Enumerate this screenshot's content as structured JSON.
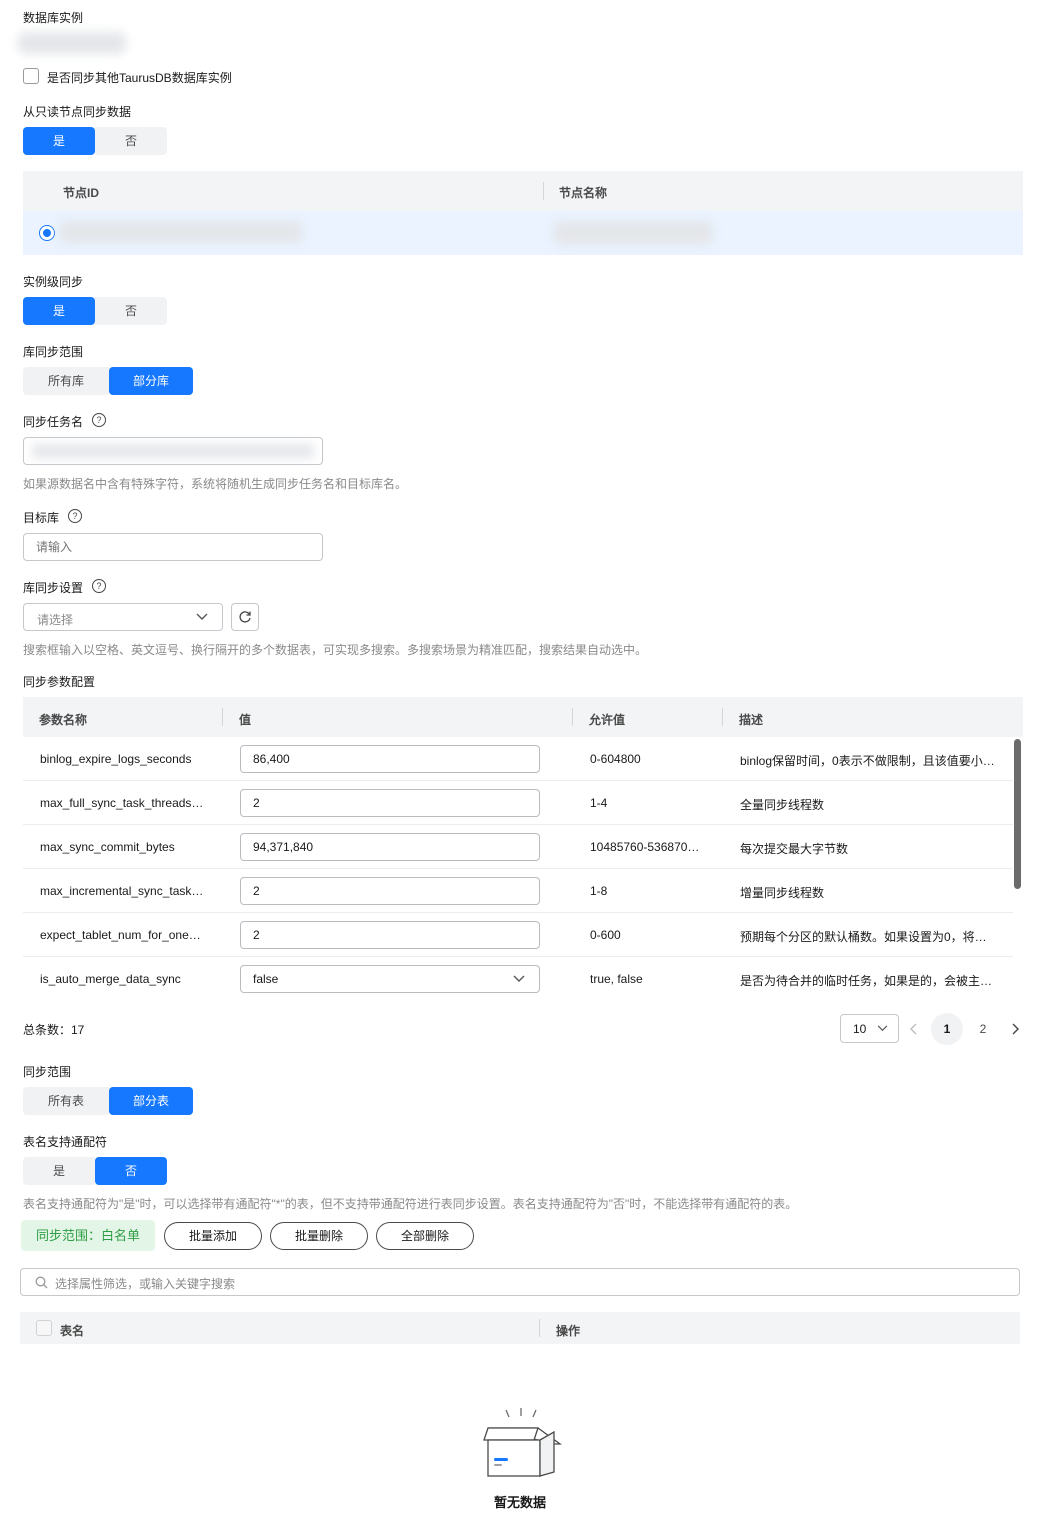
{
  "db_instance": {
    "label": "数据库实例"
  },
  "sync_other": {
    "label": "是否同步其他TaurusDB数据库实例"
  },
  "readonly_sync": {
    "label": "从只读节点同步数据",
    "options": [
      "是",
      "否"
    ],
    "selected": "是"
  },
  "node_table": {
    "headers": [
      "节点ID",
      "节点名称"
    ]
  },
  "instance_sync": {
    "label": "实例级同步",
    "options": [
      "是",
      "否"
    ],
    "selected": "是"
  },
  "db_scope": {
    "label": "库同步范围",
    "options": [
      "所有库",
      "部分库"
    ],
    "selected": "部分库"
  },
  "task_name": {
    "label": "同步任务名",
    "hint": "如果源数据名中含有特殊字符，系统将随机生成同步任务名和目标库名。"
  },
  "target_db": {
    "label": "目标库",
    "placeholder": "请输入"
  },
  "db_settings": {
    "label": "库同步设置",
    "placeholder": "请选择",
    "hint": "搜索框输入以空格、英文逗号、换行隔开的多个数据表，可实现多搜索。多搜索场景为精准匹配，搜索结果自动选中。"
  },
  "params": {
    "label": "同步参数配置",
    "headers": [
      "参数名称",
      "值",
      "允许值",
      "描述"
    ],
    "rows": [
      {
        "name": "binlog_expire_logs_seconds",
        "value": "86,400",
        "allowed": "0-604800",
        "desc": "binlog保留时间，0表示不做限制，且该值要小…"
      },
      {
        "name": "max_full_sync_task_threads…",
        "value": "2",
        "allowed": "1-4",
        "desc": "全量同步线程数"
      },
      {
        "name": "max_sync_commit_bytes",
        "value": "94,371,840",
        "allowed": "10485760-536870…",
        "desc": "每次提交最大字节数"
      },
      {
        "name": "max_incremental_sync_task…",
        "value": "2",
        "allowed": "1-8",
        "desc": "增量同步线程数"
      },
      {
        "name": "expect_tablet_num_for_one…",
        "value": "2",
        "allowed": "0-600",
        "desc": "预期每个分区的默认桶数。如果设置为0，将…"
      },
      {
        "name": "is_auto_merge_data_sync",
        "value": "false",
        "allowed": "true, false",
        "desc": "是否为待合并的临时任务，如果是的，会被主…"
      }
    ],
    "total_label": "总条数：17",
    "page_size": "10",
    "pages": [
      "1",
      "2"
    ],
    "current_page": "1"
  },
  "sync_scope": {
    "label": "同步范围",
    "options": [
      "所有表",
      "部分表"
    ],
    "selected": "部分表"
  },
  "wildcard": {
    "label": "表名支持通配符",
    "options": [
      "是",
      "否"
    ],
    "selected": "否",
    "hint": "表名支持通配符为\"是\"时，可以选择带有通配符\"*\"的表，但不支持带通配符进行表同步设置。表名支持通配符为\"否\"时，不能选择带有通配符的表。"
  },
  "whitelist": {
    "badge": "同步范围：白名单",
    "buttons": [
      "批量添加",
      "批量删除",
      "全部删除"
    ],
    "search_placeholder": "选择属性筛选，或输入关键字搜索",
    "headers": [
      "表名",
      "操作"
    ],
    "empty_text": "暂无数据"
  },
  "colors": {
    "primary": "#1677ff",
    "badge_bg": "#e3f5e6",
    "badge_text": "#2e9e44"
  }
}
